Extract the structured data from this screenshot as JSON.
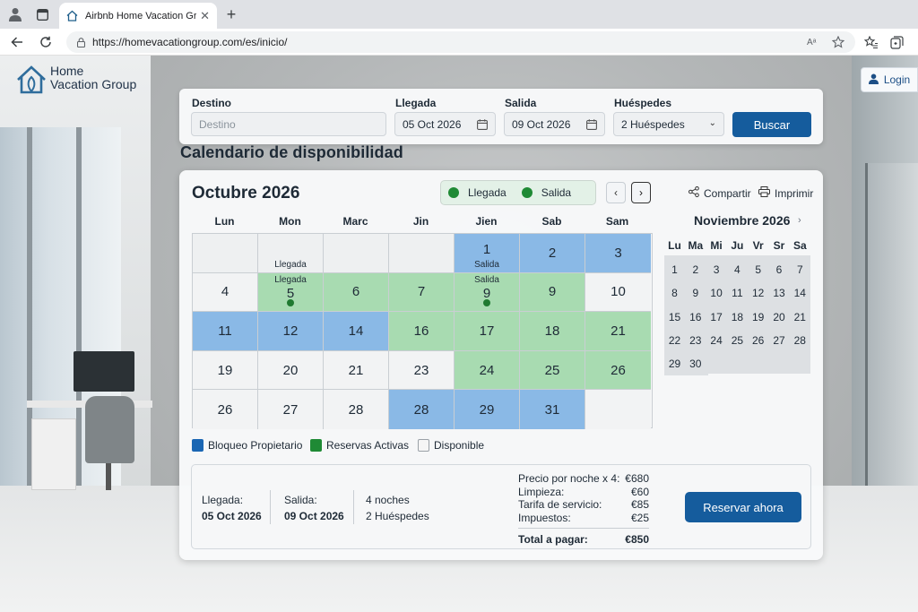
{
  "browser": {
    "tab_title": "Airbnb Home Vacation Group",
    "url": "https://homevacationgroup.com/es/inicio/",
    "read_aloud_label": "Aᵃ"
  },
  "site": {
    "logo_line1": "Home",
    "logo_line2": "Vacation Group",
    "login_label": "Login"
  },
  "search": {
    "destino_label": "Destino",
    "destino_placeholder": "Destino",
    "llegada_label": "Llegada",
    "llegada_value": "05 Oct 2026",
    "salida_label": "Salida",
    "salida_value": "09 Oct 2026",
    "huespedes_label": "Huéspedes",
    "huespedes_value": "2 Huéspedes",
    "buscar_label": "Buscar"
  },
  "calendar": {
    "section_title": "Calendario de disponibilidad",
    "month_title": "Octubre 2026",
    "legend_llegada": "Llegada",
    "legend_salida": "Salida",
    "compartir_label": "Compartir",
    "imprimir_label": "Imprimir",
    "weekdays": [
      "Lun",
      "Mon",
      "Marc",
      "Jin",
      "Jien",
      "Sab",
      "Sam"
    ],
    "cells": [
      {
        "day": "",
        "state": "empty",
        "top": "",
        "bottom": "",
        "dot": false
      },
      {
        "day": "",
        "state": "empty",
        "top": "",
        "bottom": "Llegada",
        "dot": false
      },
      {
        "day": "",
        "state": "empty",
        "top": "",
        "bottom": "",
        "dot": false
      },
      {
        "day": "",
        "state": "empty",
        "top": "",
        "bottom": "",
        "dot": false
      },
      {
        "day": "1",
        "state": "blue",
        "top": "",
        "bottom": "Salida",
        "dot": false
      },
      {
        "day": "2",
        "state": "blue",
        "top": "",
        "bottom": "",
        "dot": false
      },
      {
        "day": "3",
        "state": "blue",
        "top": "",
        "bottom": "",
        "dot": false
      },
      {
        "day": "4",
        "state": "white",
        "top": "",
        "bottom": "",
        "dot": false
      },
      {
        "day": "5",
        "state": "green",
        "top": "Llegada",
        "bottom": "",
        "dot": true
      },
      {
        "day": "6",
        "state": "green",
        "top": "",
        "bottom": "",
        "dot": false
      },
      {
        "day": "7",
        "state": "green",
        "top": "",
        "bottom": "",
        "dot": false
      },
      {
        "day": "9",
        "state": "green",
        "top": "Salida",
        "bottom": "",
        "dot": true
      },
      {
        "day": "9",
        "state": "green",
        "top": "",
        "bottom": "",
        "dot": false
      },
      {
        "day": "10",
        "state": "white",
        "top": "",
        "bottom": "",
        "dot": false
      },
      {
        "day": "11",
        "state": "blue",
        "top": "",
        "bottom": "",
        "dot": false
      },
      {
        "day": "12",
        "state": "blue",
        "top": "",
        "bottom": "",
        "dot": false
      },
      {
        "day": "14",
        "state": "blue",
        "top": "",
        "bottom": "",
        "dot": false
      },
      {
        "day": "16",
        "state": "green",
        "top": "",
        "bottom": "",
        "dot": false
      },
      {
        "day": "17",
        "state": "green",
        "top": "",
        "bottom": "",
        "dot": false
      },
      {
        "day": "18",
        "state": "green",
        "top": "",
        "bottom": "",
        "dot": false
      },
      {
        "day": "21",
        "state": "green",
        "top": "",
        "bottom": "",
        "dot": false
      },
      {
        "day": "19",
        "state": "white",
        "top": "",
        "bottom": "",
        "dot": false
      },
      {
        "day": "20",
        "state": "white",
        "top": "",
        "bottom": "",
        "dot": false
      },
      {
        "day": "21",
        "state": "white",
        "top": "",
        "bottom": "",
        "dot": false
      },
      {
        "day": "23",
        "state": "white",
        "top": "",
        "bottom": "",
        "dot": false
      },
      {
        "day": "24",
        "state": "green",
        "top": "",
        "bottom": "",
        "dot": false
      },
      {
        "day": "25",
        "state": "green",
        "top": "",
        "bottom": "",
        "dot": false
      },
      {
        "day": "26",
        "state": "green",
        "top": "",
        "bottom": "",
        "dot": false
      },
      {
        "day": "26",
        "state": "white",
        "top": "",
        "bottom": "",
        "dot": false
      },
      {
        "day": "27",
        "state": "white",
        "top": "",
        "bottom": "",
        "dot": false
      },
      {
        "day": "28",
        "state": "white",
        "top": "",
        "bottom": "",
        "dot": false
      },
      {
        "day": "28",
        "state": "blue",
        "top": "",
        "bottom": "",
        "dot": false
      },
      {
        "day": "29",
        "state": "blue",
        "top": "",
        "bottom": "",
        "dot": false
      },
      {
        "day": "31",
        "state": "blue",
        "top": "",
        "bottom": "",
        "dot": false
      },
      {
        "day": "",
        "state": "white",
        "top": "",
        "bottom": "",
        "dot": false
      }
    ]
  },
  "mini_calendar": {
    "title": "Noviembre 2026",
    "weekdays": [
      "Lu",
      "Ma",
      "Mi",
      "Ju",
      "Vr",
      "Sr",
      "Sa"
    ],
    "days": [
      "1",
      "2",
      "3",
      "4",
      "5",
      "6",
      "7",
      "8",
      "9",
      "10",
      "11",
      "12",
      "13",
      "14",
      "15",
      "16",
      "17",
      "18",
      "19",
      "20",
      "21",
      "22",
      "23",
      "24",
      "25",
      "26",
      "27",
      "28",
      "29",
      "30"
    ]
  },
  "legend": {
    "bloqueo": "Bloqueo Propietario",
    "reservas": "Reservas Activas",
    "disponible": "Disponible"
  },
  "summary": {
    "llegada_label": "Llegada:",
    "llegada_value": "05 Oct 2026",
    "salida_label": "Salida:",
    "salida_value": "09 Oct 2026",
    "noches": "4 noches",
    "huespedes": "2 Huéspedes",
    "price_rows": [
      {
        "label": "Precio por noche x 4:",
        "value": "€680"
      },
      {
        "label": "Limpieza:",
        "value": "€60"
      },
      {
        "label": "Tarifa de servicio:",
        "value": "€85"
      },
      {
        "label": "Impuestos:",
        "value": "€25"
      }
    ],
    "total_label": "Total a pagar:",
    "total_value": "€850",
    "reservar_label": "Reservar ahora"
  },
  "colors": {
    "accent": "#155c9d",
    "blocked": "#8ab9e6",
    "active": "#a8dbb1",
    "available": "#f2f3f4"
  }
}
